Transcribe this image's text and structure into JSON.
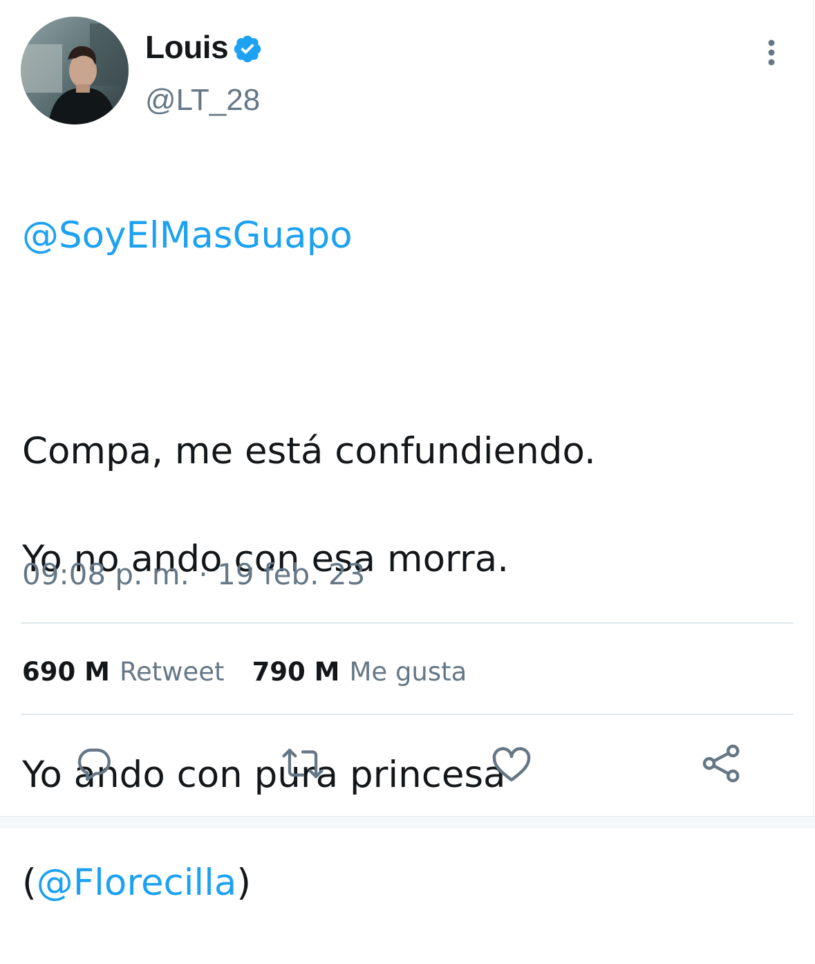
{
  "author": {
    "display_name": "Louis",
    "handle": "@LT_28",
    "verified": true,
    "avatar_icon": "profile-photo"
  },
  "tweet": {
    "reply_mention": "@SoyElMasGuapo",
    "line1": "Compa, me está confundiendo.",
    "line2": "Yo no ando con esa morra.",
    "line3": "Yo ando con pura princesa",
    "paren_open": "(",
    "inline_mention": "@Florecilla",
    "paren_close": ")"
  },
  "timestamp": "09:08 p. m. · 19 feb. 23",
  "stats": {
    "retweet_count": "690 M",
    "retweet_label": "Retweet",
    "like_count": "790 M",
    "like_label": "Me gusta"
  },
  "actions": [
    {
      "icon": "reply-icon"
    },
    {
      "icon": "retweet-icon"
    },
    {
      "icon": "like-icon"
    },
    {
      "icon": "share-icon"
    }
  ],
  "colors": {
    "mention": "#1da1f2",
    "secondary_text": "#657786",
    "verified_badge": "#1da1f2",
    "divider": "#e1e8ed"
  }
}
